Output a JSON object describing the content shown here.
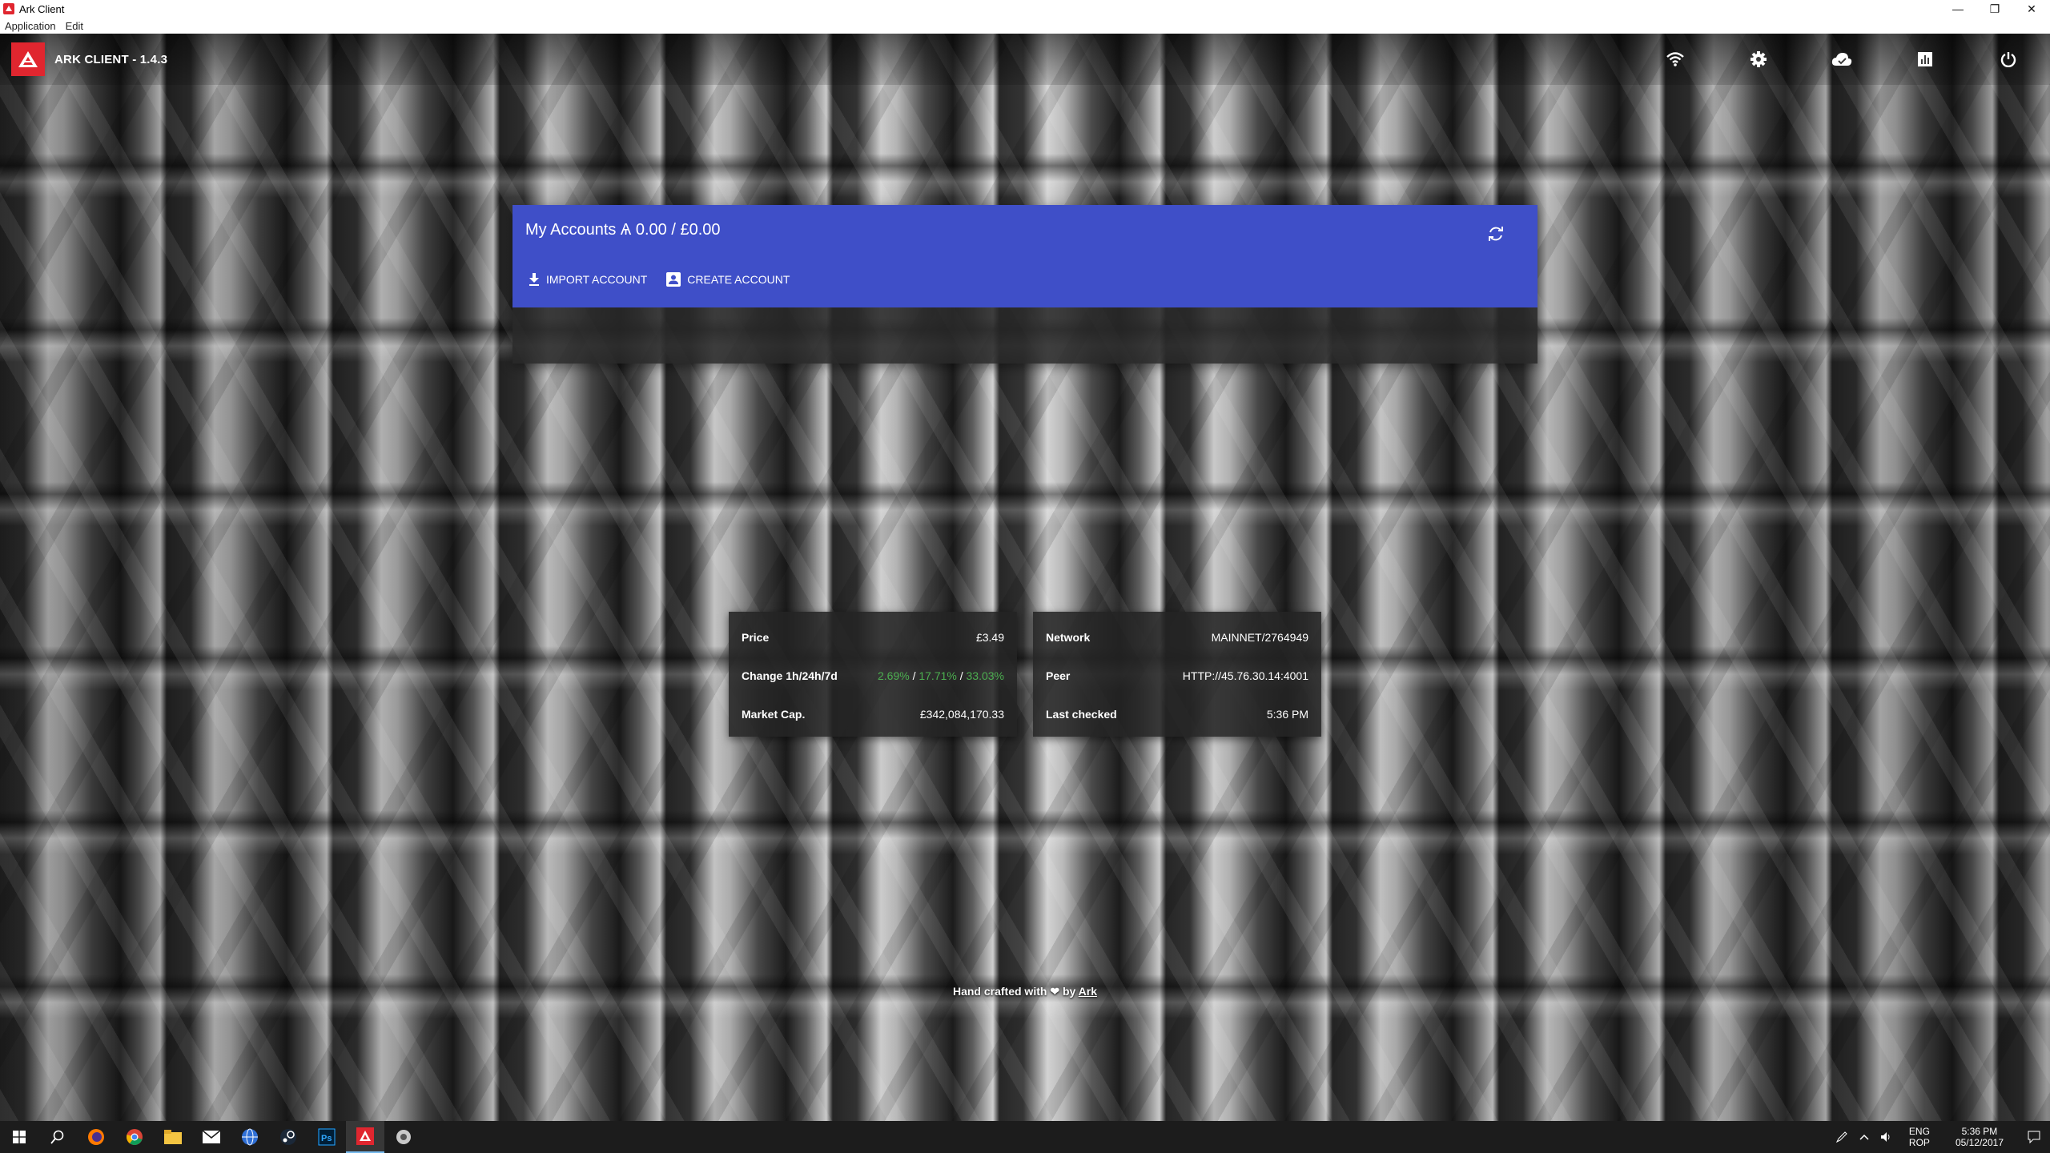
{
  "window": {
    "title": "Ark Client",
    "controls": {
      "minimize": "—",
      "restore": "❐",
      "close": "✕"
    }
  },
  "menubar": {
    "items": [
      "Application",
      "Edit"
    ]
  },
  "appbar": {
    "title": "ARK CLIENT - 1.4.3",
    "icons": [
      "wifi-icon",
      "settings-icon",
      "cloud-icon",
      "chart-icon",
      "power-icon"
    ]
  },
  "accounts": {
    "title": "My Accounts Ѧ 0.00 / £0.00",
    "import_label": "IMPORT ACCOUNT",
    "create_label": "CREATE ACCOUNT"
  },
  "market": {
    "price_label": "Price",
    "price_value": "£3.49",
    "change_label": "Change 1h/24h/7d",
    "change_1h": "2.69%",
    "change_24h": "17.71%",
    "change_7d": "33.03%",
    "change_sep": "/",
    "marketcap_label": "Market Cap.",
    "marketcap_value": "£342,084,170.33"
  },
  "network": {
    "network_label": "Network",
    "network_value": "MAINNET/2764949",
    "peer_label": "Peer",
    "peer_value": "HTTP://45.76.30.14:4001",
    "checked_label": "Last checked",
    "checked_value": "5:36 PM"
  },
  "footer": {
    "prefix": "Hand crafted with",
    "by": "by",
    "link": "Ark"
  },
  "taskbar": {
    "lang_top": "ENG",
    "lang_bottom": "ROP",
    "time": "5:36 PM",
    "date": "05/12/2017"
  },
  "colors": {
    "accent_blue": "#3f4fc8",
    "brand_red": "#e0262f",
    "positive_green": "#4caf50"
  }
}
